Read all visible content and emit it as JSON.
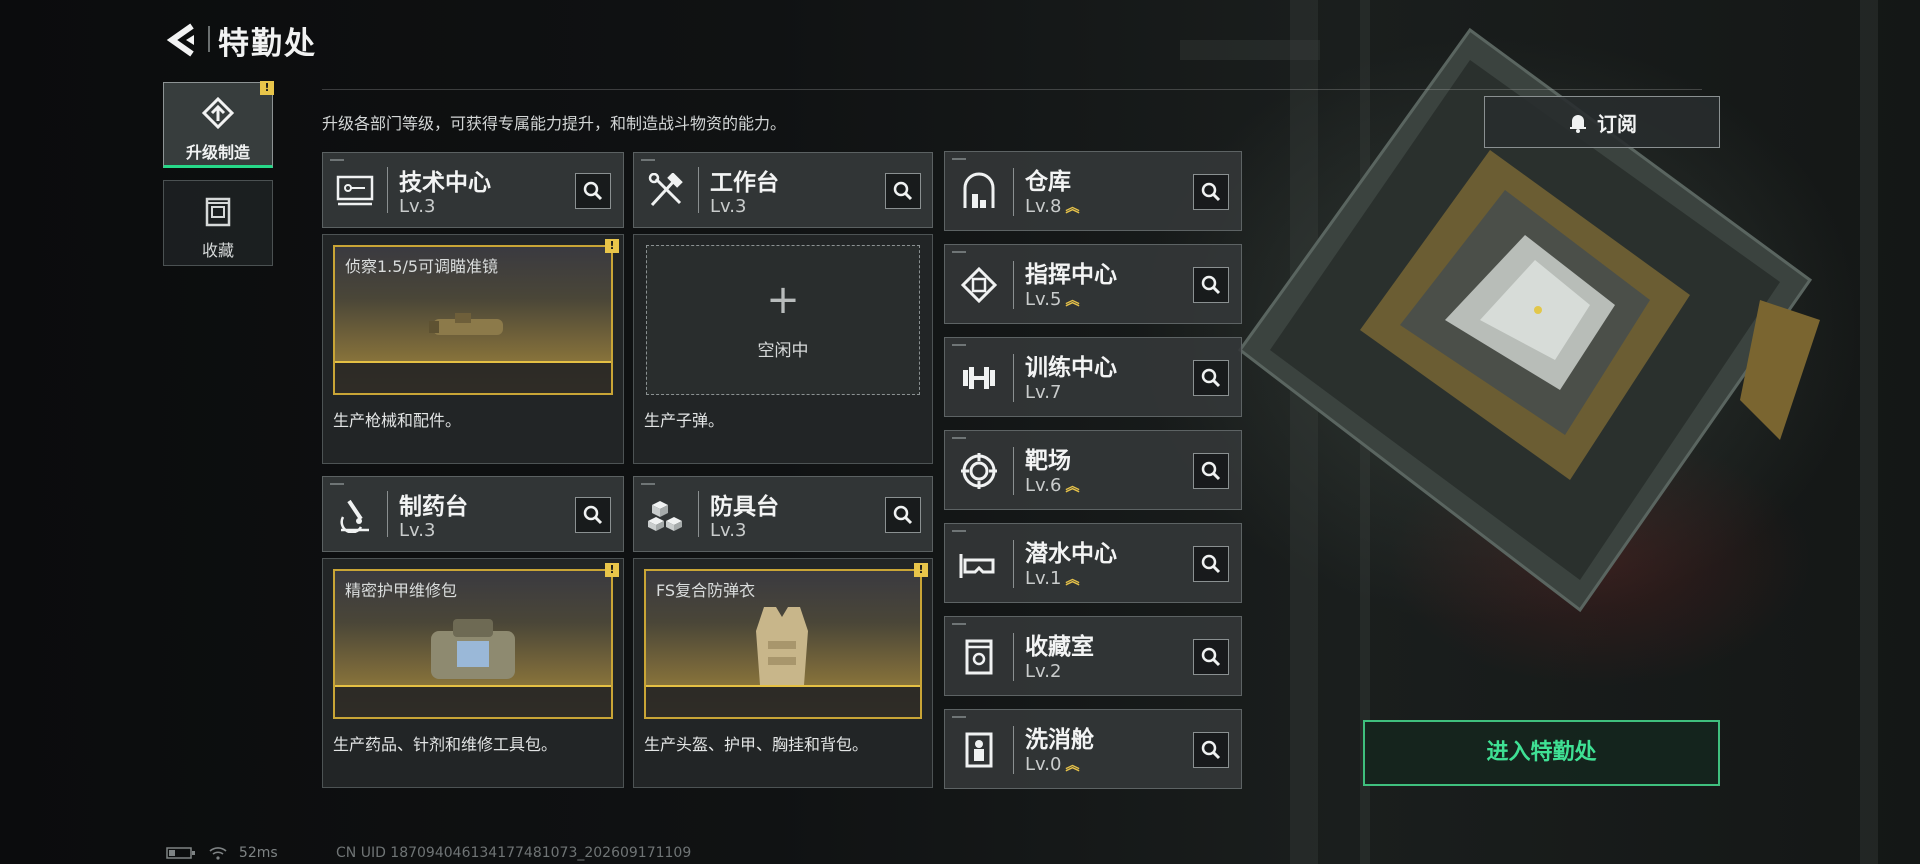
{
  "header": {
    "title": "特勤处"
  },
  "description": "升级各部门等级，可获得专属能力提升，和制造战斗物资的能力。",
  "tabs": [
    {
      "label": "升级制造",
      "active": true,
      "alert": "!"
    },
    {
      "label": "收藏",
      "active": false
    }
  ],
  "cards": {
    "tech": {
      "name": "技术中心",
      "level": "Lv.3",
      "product": "侦察1.5/5可调瞄准镜",
      "alert": "!",
      "desc": "生产枪械和配件。"
    },
    "workbench": {
      "name": "工作台",
      "level": "Lv.3",
      "idle": "空闲中",
      "plus": "+",
      "desc": "生产子弹。"
    },
    "pharmacy": {
      "name": "制药台",
      "level": "Lv.3",
      "product": "精密护甲维修包",
      "alert": "!",
      "desc": "生产药品、针剂和维修工具包。"
    },
    "armor": {
      "name": "防具台",
      "level": "Lv.3",
      "product": "FS复合防弹衣",
      "alert": "!",
      "desc": "生产头盔、护甲、胸挂和背包。"
    }
  },
  "facilities": [
    {
      "name": "仓库",
      "level": "Lv.8",
      "upgrade": "︽",
      "icon": "warehouse-icon"
    },
    {
      "name": "指挥中心",
      "level": "Lv.5",
      "upgrade": "︽",
      "icon": "command-chip-icon"
    },
    {
      "name": "训练中心",
      "level": "Lv.7",
      "upgrade": "",
      "icon": "dumbbell-icon"
    },
    {
      "name": "靶场",
      "level": "Lv.6",
      "upgrade": "︽",
      "icon": "target-icon"
    },
    {
      "name": "潜水中心",
      "level": "Lv.1",
      "upgrade": "︽",
      "icon": "diving-mask-icon"
    },
    {
      "name": "收藏室",
      "level": "Lv.2",
      "upgrade": "",
      "icon": "collection-icon"
    },
    {
      "name": "洗消舱",
      "level": "Lv.0",
      "upgrade": "︽",
      "icon": "decon-icon"
    }
  ],
  "subscribe_label": "订阅",
  "enter_label": "进入特勤处",
  "status_bar": {
    "ping": "52ms",
    "uid": "CN UID 1870940461341774810​73_202609171109"
  },
  "colors": {
    "accent_green": "#3fe094",
    "alert_yellow": "#e8c54a",
    "product_gold": "#c9a536"
  }
}
